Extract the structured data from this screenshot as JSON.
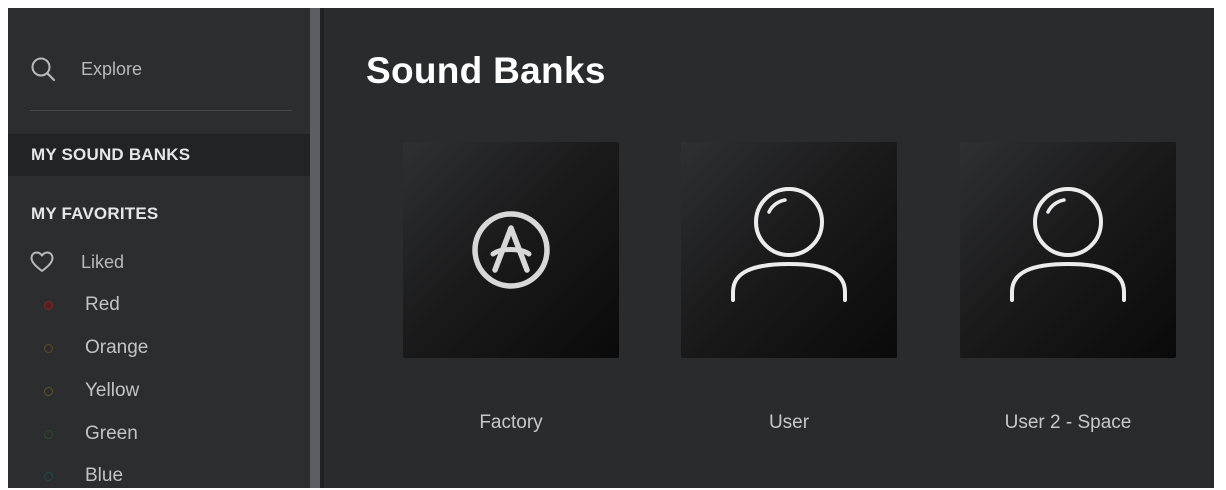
{
  "sidebar": {
    "search": {
      "label": "Explore",
      "icon": "search-icon"
    },
    "my_sound_banks": "MY SOUND BANKS",
    "my_favorites": "MY FAVORITES",
    "liked": {
      "label": "Liked",
      "icon": "heart-icon"
    },
    "colors": [
      {
        "label": "Red",
        "color": "#7a2a2a"
      },
      {
        "label": "Orange",
        "color": "#5e4a22"
      },
      {
        "label": "Yellow",
        "color": "#5e5522"
      },
      {
        "label": "Green",
        "color": "#2f4a2f"
      },
      {
        "label": "Blue",
        "color": "#1f4a4a"
      }
    ]
  },
  "main": {
    "title": "Sound Banks",
    "banks": [
      {
        "label": "Factory",
        "icon": "arturia-logo-icon"
      },
      {
        "label": "User",
        "icon": "user-icon"
      },
      {
        "label": "User 2 - Space",
        "icon": "user-icon"
      }
    ]
  }
}
